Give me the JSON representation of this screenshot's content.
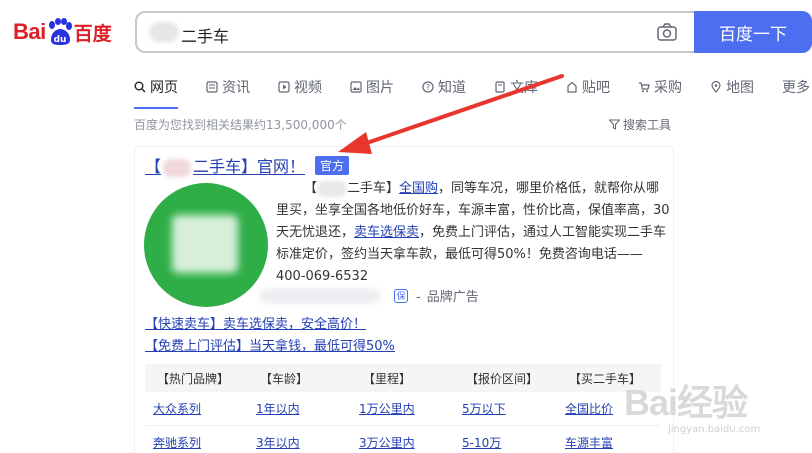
{
  "logo": {
    "bai": "Bai",
    "du": "百度",
    "paw_text": "du"
  },
  "search": {
    "query": "二手车",
    "button": "百度一下"
  },
  "tabs": [
    {
      "label": "网页",
      "icon": "search-icon",
      "active": true
    },
    {
      "label": "资讯",
      "icon": "news-icon"
    },
    {
      "label": "视频",
      "icon": "video-icon"
    },
    {
      "label": "图片",
      "icon": "image-icon"
    },
    {
      "label": "知道",
      "icon": "question-icon"
    },
    {
      "label": "文库",
      "icon": "doc-icon"
    },
    {
      "label": "贴吧",
      "icon": "tieba-icon"
    },
    {
      "label": "采购",
      "icon": "cart-icon"
    },
    {
      "label": "地图",
      "icon": "map-icon"
    },
    {
      "label": "更多",
      "icon": ""
    }
  ],
  "result_count": "百度为您找到相关结果约13,500,000个",
  "search_tools": "搜索工具",
  "result": {
    "title_prefix": "【",
    "title_main": "二手车】官网！",
    "badge": "官方",
    "desc_part1": "【",
    "desc_part2": "二手车】",
    "desc_link1": "全国购",
    "desc_part3": "，同等车况，哪里价格低，就帮你从哪里买，坐享全国各地低价好车，车源丰富，性价比高，保值率高，30天无忧退还，",
    "desc_link2": "卖车选保卖",
    "desc_part4": "，免费上门评估，通过人工智能实现二手车标准定价，签约当天拿车款，最低可得50%！免费咨询电话——400-069-6532",
    "guarantee_label": "保",
    "brand_ad": "品牌广告",
    "sub_links": [
      "【快速卖车】卖车选保卖，安全高价！",
      "【免费上门评估】当天拿钱，最低可得50%"
    ],
    "table": {
      "headers": [
        "【热门品牌】",
        "【车龄】",
        "【里程】",
        "【报价区间】",
        "【买二手车】"
      ],
      "rows": [
        [
          "大众系列",
          "1年以内",
          "1万公里内",
          "5万以下",
          "全国比价"
        ],
        [
          "奔驰系列",
          "3年以内",
          "3万公里内",
          "5-10万",
          "车源丰富"
        ]
      ]
    }
  },
  "watermark": {
    "text": "Bai经验",
    "url": "jingyan.baidu.com"
  },
  "colors": {
    "brand_red": "#de1f26",
    "brand_blue": "#4e6ef2",
    "link": "#2440b3",
    "green": "#2fae48",
    "arrow": "#e8362f"
  }
}
